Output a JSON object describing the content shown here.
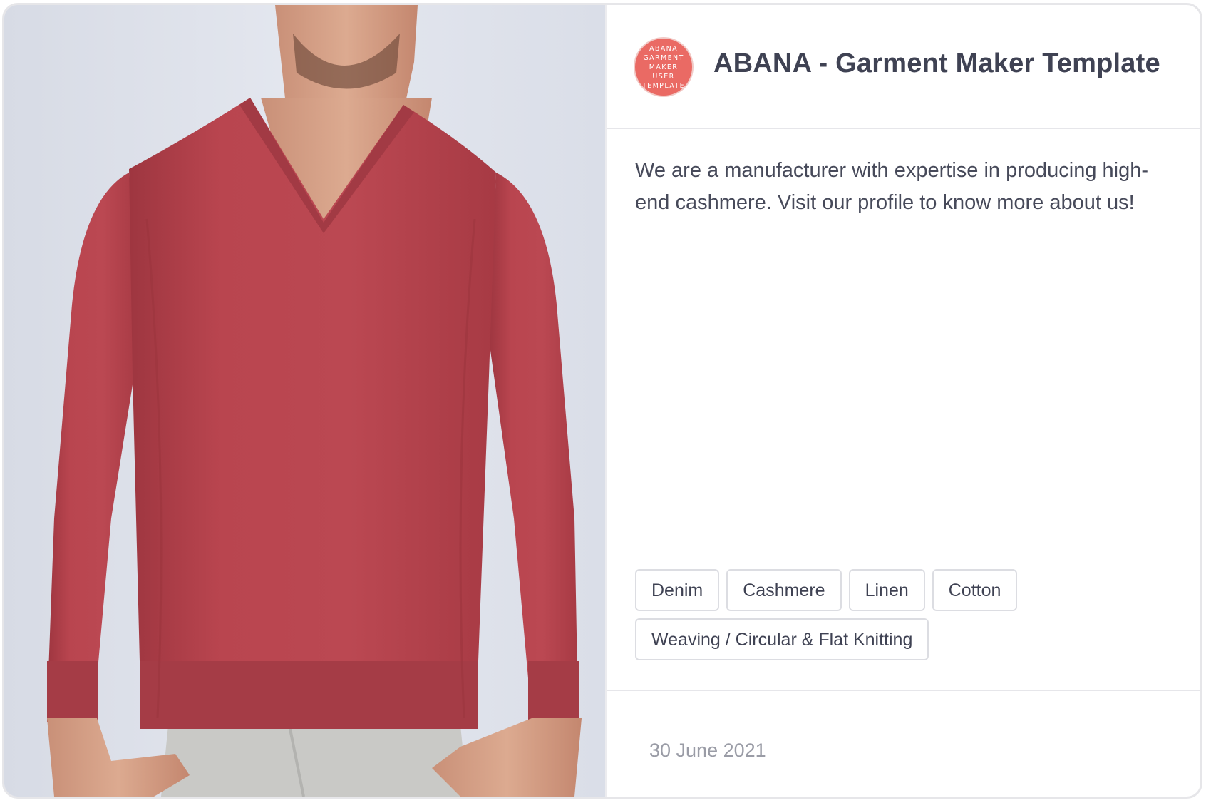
{
  "card": {
    "image_alt": "photo",
    "avatar": {
      "lines": [
        "ABANA",
        "GARMENT",
        "MAKER",
        "USER",
        "TEMPLATE"
      ],
      "color": "#ea6a64"
    },
    "title": "ABANA - Garment Maker Template",
    "description": "We are a manufacturer with expertise in producing high-end cashmere. Visit our profile to know more about us!",
    "tags": [
      "Denim",
      "Cashmere",
      "Linen",
      "Cotton",
      "Weaving / Circular & Flat Knitting"
    ],
    "date": "30 June 2021"
  },
  "colors": {
    "sweater": "#b6424c",
    "background": "#e0e3eb",
    "title_text": "#3f4253",
    "date_text": "#9a9ca6"
  }
}
